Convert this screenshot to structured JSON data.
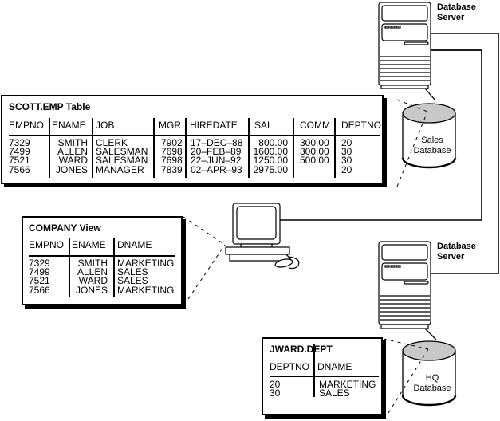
{
  "servers": [
    {
      "label_line1": "Database",
      "label_line2": "Server"
    },
    {
      "label_line1": "Database",
      "label_line2": "Server"
    }
  ],
  "databases": [
    {
      "label_line1": "Sales",
      "label_line2": "Database"
    },
    {
      "label_line1": "HQ",
      "label_line2": "Database"
    }
  ],
  "scott_emp": {
    "title": "SCOTT.EMP Table",
    "columns": [
      "EMPNO",
      "ENAME",
      "JOB",
      "MGR",
      "HIREDATE",
      "SAL",
      "COMM",
      "DEPTNO"
    ],
    "rows": [
      [
        "7329",
        "SMITH",
        "CLERK",
        "7902",
        "17–DEC–88",
        "800.00",
        "300.00",
        "20"
      ],
      [
        "7499",
        "ALLEN",
        "SALESMAN",
        "7698",
        "20–FEB–89",
        "1600.00",
        "300.00",
        "30"
      ],
      [
        "7521",
        "WARD",
        "SALESMAN",
        "7698",
        "22–JUN–92",
        "1250.00",
        "500.00",
        "30"
      ],
      [
        "7566",
        "JONES",
        "MANAGER",
        "7839",
        "02–APR–93",
        "2975.00",
        "",
        "20"
      ]
    ]
  },
  "company_view": {
    "title": "COMPANY View",
    "columns": [
      "EMPNO",
      "ENAME",
      "DNAME"
    ],
    "rows": [
      [
        "7329",
        "SMITH",
        "MARKETING"
      ],
      [
        "7499",
        "ALLEN",
        "SALES"
      ],
      [
        "7521",
        "WARD",
        "SALES"
      ],
      [
        "7566",
        "JONES",
        "MARKETING"
      ]
    ]
  },
  "jward_dept": {
    "title": "JWARD.DEPT",
    "columns": [
      "DEPTNO",
      "DNAME"
    ],
    "rows": [
      [
        "20",
        "MARKETING"
      ],
      [
        "30",
        "SALES"
      ]
    ]
  }
}
